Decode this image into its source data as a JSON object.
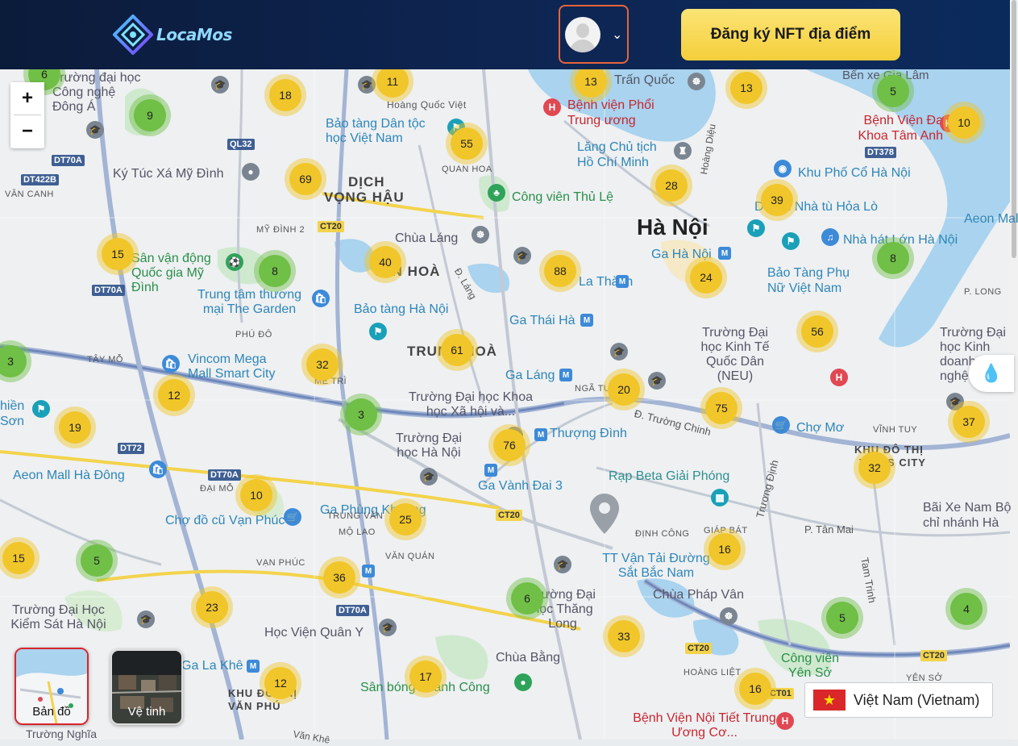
{
  "header": {
    "logo_text": "LocaMos",
    "nft_button": "Đăng ký NFT địa điểm"
  },
  "map": {
    "zoom_in": "+",
    "zoom_out": "−",
    "city": "Hà Nội",
    "districts": [
      "DỊCH",
      "VỌNG HẬU",
      "YÊN HOÀ",
      "TRUNG HOÀ",
      "KHU ĐÔ THỊ",
      "TIMES CITY",
      "KHU ĐÔ THỊ",
      "VĂN PHÚ"
    ],
    "place_labels": {
      "dh_cong_nghe": "Trường đại học Công nghệ Đông Á",
      "hoang_quoc_viet": "Hoàng Quốc Việt",
      "bao_tang_dan_toc": "Bảo tàng Dân tộc học Việt Nam",
      "tran_quoc": "Trấn Quốc",
      "bv_phoi": "Bệnh viện Phổi Trung ương",
      "ben_xe_gia_lam": "Bến xe Gia Lâm",
      "bv_tam_anh": "Bệnh Viện Đa Khoa Tâm Anh",
      "lang_chu_tich": "Lăng Chủ tịch Hồ Chí Minh",
      "ktx_my_dinh": "Ký Túc Xá Mỹ Đình",
      "khu_pho_co": "Khu Phố Cổ Hà Nội",
      "cong_vien_thu_le": "Công viên Thủ Lệ",
      "di_tich_hoa_lo": "Di tích Nhà tù Hỏa Lò",
      "aeon_long_bien": "Aeon Mall",
      "chua_lang": "Chùa Láng",
      "nha_hat_lon": "Nhà hát Lớn Hà Nội",
      "svd_my_dinh": "Sân vận động Quốc gia Mỹ Đình",
      "ga_ha_noi": "Ga Hà Nội",
      "bao_tang_phu_nu": "Bảo Tàng Phụ Nữ Việt Nam",
      "la_thanh": "La Thành",
      "tt_the_garden": "Trung tâm thương mại The Garden",
      "bao_tang_ha_noi": "Bảo tàng Hà Nội",
      "ga_thai_ha": "Ga Thái Hà",
      "dh_kinh_te": "Trường Đại học Kinh Tế Quốc Dân (NEU)",
      "dh_kinh_doanh": "Trường Đại học Kinh doanh Công nghệ",
      "vincom": "Vincom Mega Mall Smart City",
      "ga_lang": "Ga Láng",
      "dh_khxh": "Trường Đại học Khoa học Xã hội và...",
      "cho_mo": "Chợ Mơ",
      "dh_ha_noi": "Trường Đại học Hà Nội",
      "thuong_dinh": "Thượng Đình",
      "aeon_ha_dong": "Aeon Mall Hà Đông",
      "ga_vanh_dai_3": "Ga Vành Đai 3",
      "rap_beta": "Rạp Beta Giải Phóng",
      "ga_phung_khoang": "Ga Phùng Khoang",
      "cho_do_cu": "Chợ đồ cũ Vạn Phúc",
      "bai_xe_nam": "Bãi Xe Nam Bộ chỉ nhánh Hà",
      "tt_van_tai": "TT Vận Tải Đường Sắt Bắc Nam",
      "chua_phap_van": "Chùa Pháp Vân",
      "dh_kiem_sat": "Trường Đại Học Kiểm Sát Hà Nội",
      "hv_quan_y": "Học Viện Quân Y",
      "dh_thang_long": "Trường Đại học Thăng Long",
      "ga_la_khe": "Ga La Khê",
      "chua_bang": "Chùa Bằng",
      "cv_yen_so": "Công viên Yên Sở",
      "san_bong": "Sân bóng Thành Công",
      "bv_noi_tiet": "Bệnh Viện Nội Tiết Trung Ương Cơ...",
      "mien_son": "hiền Sơn",
      "truong_nghia": "Trường Nghĩa"
    },
    "small_labels": [
      "QUAN HOA",
      "VĂN CANH",
      "MỸ ĐÌNH 2",
      "PHÚ ĐÔ",
      "TÂY MỖ",
      "MỄ TRÌ",
      "NGÃ TƯ",
      "ĐẠI MỖ",
      "TRUNG VĂN",
      "MỘ LAO",
      "VẠN PHÚC",
      "VĂN QUÁN",
      "ĐỊNH CÔNG",
      "GIÁP BÁT",
      "VĨNH TUY",
      "HOÀNG LIỆT",
      "YÊN SỞ",
      "P. LONG",
      "P. Tân Mai",
      "Hoàng Diệu",
      "Đ. Láng",
      "Đ. Trường Chinh",
      "Trương Định",
      "Tam Trinh",
      "Văn Khê"
    ],
    "road_labels": [
      "DT70A",
      "DT422B",
      "QL32",
      "CT20",
      "DT70A",
      "DT72",
      "DT70A",
      "CT20",
      "DT70A",
      "CT20",
      "CT20",
      "DT378",
      "CT01"
    ],
    "clusters": [
      6,
      9,
      18,
      11,
      13,
      13,
      5,
      10,
      55,
      69,
      28,
      39,
      15,
      8,
      40,
      88,
      24,
      8,
      3,
      32,
      61,
      56,
      12,
      3,
      20,
      75,
      19,
      76,
      37,
      32,
      10,
      25,
      15,
      5,
      36,
      16,
      23,
      6,
      33,
      5,
      4,
      12,
      17,
      16
    ]
  },
  "layer_switch": {
    "map_label": "Bản đồ",
    "satellite_label": "Vệ tinh"
  },
  "language": {
    "label": "Việt Nam (Vietnam)"
  },
  "colors": {
    "header_bg": "#0e2552",
    "accent_button": "#f5cf3a",
    "cluster_yellow": "#f1c62a",
    "cluster_green": "#70bf46",
    "avatar_border": "#e8643b"
  }
}
